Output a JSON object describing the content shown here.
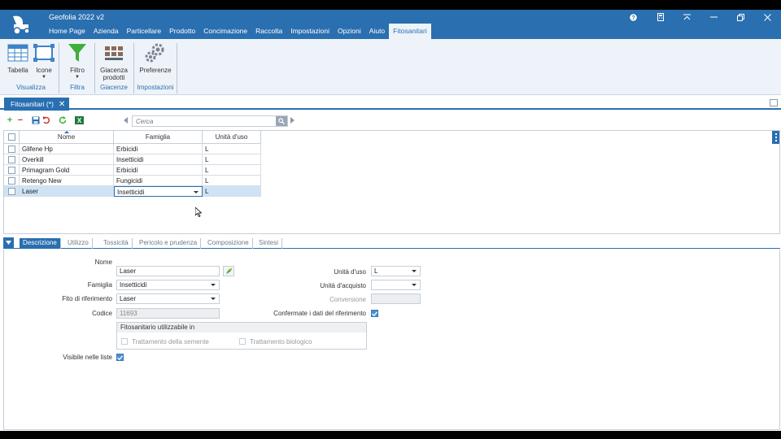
{
  "app": {
    "title": "Geofolia 2022 v2",
    "menu": [
      "Home Page",
      "Azienda",
      "Particellare",
      "Prodotto",
      "Concimazione",
      "Raccolta",
      "Impostazioni",
      "Opzioni",
      "Aiuto",
      "Fitosanitari"
    ],
    "active_menu": "Fitosanitari"
  },
  "ribbon": {
    "tabella": "Tabella",
    "icone": "Icone",
    "visualizza": "Visualizza",
    "filtro": "Filtro",
    "filtra": "Filtra",
    "giacenza_prodotti": "Giacenza prodotti",
    "giacenze": "Giacenze",
    "preferenze": "Preferenze",
    "impostazioni": "Impostazioni"
  },
  "document_tab": {
    "label": "Fitosanitari (*)"
  },
  "search": {
    "placeholder": "Cerca"
  },
  "grid": {
    "columns": [
      "Nome",
      "Famiglia",
      "Unità d'uso"
    ],
    "rows": [
      {
        "nome": "Glifene Hp",
        "famiglia": "Erbicidi",
        "unita": "L"
      },
      {
        "nome": "Overkill",
        "famiglia": "Insetticidi",
        "unita": "L"
      },
      {
        "nome": "Primagram Gold",
        "famiglia": "Erbicidi",
        "unita": "L"
      },
      {
        "nome": "Retengo New",
        "famiglia": "Fungicidi",
        "unita": "L"
      },
      {
        "nome": "Laser",
        "famiglia": "Insetticidi",
        "unita": "L"
      }
    ]
  },
  "detail_tabs": [
    "Descrizione",
    "Utilizzo",
    "Tossicità",
    "Pericolo e prudenza",
    "Composizione",
    "Sintesi"
  ],
  "form": {
    "nome_label": "Nome",
    "nome_value": "Laser",
    "famiglia_label": "Famiglia",
    "famiglia_value": "Insetticidi",
    "fito_label": "Fito di riferimento",
    "fito_value": "Laser",
    "codice_label": "Codice",
    "codice_value": "11693",
    "usable_title": "Fitosanitario utilizzabile in",
    "trattamento_semente": "Trattamento della semente",
    "trattamento_biologico": "Trattamento biologico",
    "visibile_label": "Visibile nelle liste",
    "unita_uso_label": "Unità d'uso",
    "unita_uso_value": "L",
    "unita_acquisto_label": "Unità d'acquisto",
    "unita_acquisto_value": "",
    "conversione_label": "Conversione",
    "confermate_label": "Confermate i dati del riferimento"
  },
  "colors": {
    "accent": "#2a6fb0",
    "ribbon_bg": "#eef3f9",
    "selected_row": "#cfe3f5"
  }
}
